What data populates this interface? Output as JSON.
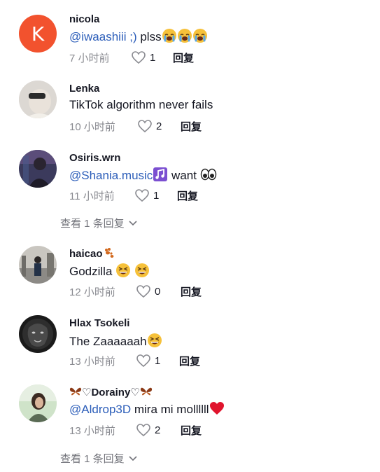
{
  "comments": [
    {
      "username": "nicola",
      "avatar_letter": "K",
      "mention": "@iwaashiii ;)",
      "text": " plss",
      "emoji_names": [
        "loudly-crying-face",
        "loudly-crying-face",
        "loudly-crying-face"
      ],
      "time": "7 小时前",
      "likes": "1",
      "reply": "回复"
    },
    {
      "username": "Lenka",
      "text": "TikTok algorithm never fails",
      "time": "10 小时前",
      "likes": "2",
      "reply": "回复"
    },
    {
      "username": "Osiris.wrn",
      "mention": "@Shania.music",
      "text": " want ",
      "emoji_names": [
        "musical-notes",
        "eyes"
      ],
      "time": "11 小时前",
      "likes": "1",
      "reply": "回复",
      "view_replies": "查看 1 条回复"
    },
    {
      "username": "haicao",
      "username_emoji": "paw-prints",
      "text": "Godzilla ",
      "emoji_names": [
        "grinning-squinting-face",
        "grinning-squinting-face"
      ],
      "time": "12 小时前",
      "likes": "0",
      "reply": "回复"
    },
    {
      "username": "Hlax Tsokeli",
      "text": "The Zaaaaaah",
      "emoji_names": [
        "grinning-squinting-face"
      ],
      "time": "13 小时前",
      "likes": "1",
      "reply": "回复"
    },
    {
      "username": "♡Dorainy♡",
      "username_emoji": "butterfly",
      "mention": "@Aldrop3D",
      "text": " mira mi mollllll",
      "emoji_names": [
        "red-heart"
      ],
      "time": "13 小时前",
      "likes": "2",
      "reply": "回复",
      "view_replies": "查看 1 条回复"
    }
  ],
  "colors": {
    "mention": "#2b5db9",
    "meta_gray": "#8a8b91",
    "avatar_k": "#f2522e"
  }
}
